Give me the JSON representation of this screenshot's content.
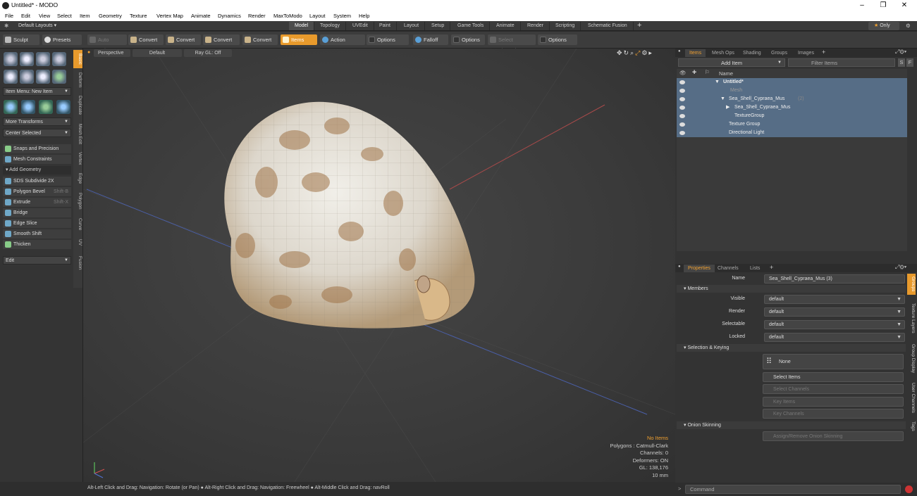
{
  "window": {
    "title": "Untitled* - MODO"
  },
  "menu": [
    "File",
    "Edit",
    "View",
    "Select",
    "Item",
    "Geometry",
    "Texture",
    "Vertex Map",
    "Animate",
    "Dynamics",
    "Render",
    "MaxToModo",
    "Layout",
    "System",
    "Help"
  ],
  "layouts": {
    "label": "Default Layouts ▾"
  },
  "tabs": [
    "Model",
    "Topology",
    "UVEdit",
    "Paint",
    "Layout",
    "Setup",
    "Game Tools",
    "Animate",
    "Render",
    "Scripting",
    "Schematic Fusion"
  ],
  "only_label": "Only",
  "toolbar": {
    "sculpt": "Sculpt",
    "presets": "Presets",
    "presets_key": "F6",
    "auto_select": "Auto Select",
    "convert": "Convert",
    "items": "Items",
    "action_center": "Action Center",
    "options": "Options",
    "falloff": "Falloff",
    "select_through": "Select Through"
  },
  "left": {
    "item_menu": "Item Menu: New Item",
    "more_transforms": "More Transforms",
    "center_selected": "Center Selected",
    "snaps": "Snaps and Precision",
    "mesh_constraints": "Mesh Constraints",
    "add_geometry": "Add Geometry",
    "tools": [
      {
        "label": "SDS Subdivide 2X",
        "key": ""
      },
      {
        "label": "Polygon Bevel",
        "key": "Shift-B"
      },
      {
        "label": "Extrude",
        "key": "Shift-X"
      },
      {
        "label": "Bridge",
        "key": ""
      },
      {
        "label": "Edge Slice",
        "key": ""
      },
      {
        "label": "Smooth Shift",
        "key": ""
      },
      {
        "label": "Thicken",
        "key": ""
      }
    ],
    "edit": "Edit",
    "vtabs": [
      "Basic",
      "Deform",
      "Duplicate",
      "Mesh Edit",
      "Vertex",
      "Edge",
      "Polygon",
      "Curve",
      "UV",
      "Fusion"
    ]
  },
  "viewport": {
    "perspective": "Perspective",
    "default": "Default",
    "raygl": "Ray GL: Off",
    "info": {
      "no_items": "No Items",
      "polygons": "Polygons : Catmull-Clark",
      "channels": "Channels: 0",
      "deformers": "Deformers: ON",
      "gl": "GL: 138,176",
      "scale": "10 mm"
    }
  },
  "status": "Alt-Left Click and Drag: Navigation: Rotate (or Pan) ● Alt-Right Click and Drag: Navigation: Freewheel ● Alt-Middle Click and Drag: navRoll",
  "items_panel": {
    "tabs": [
      "Items",
      "Mesh Ops",
      "Shading",
      "Groups",
      "Images"
    ],
    "add_item": "Add Item",
    "filter": "Filter Items",
    "col_name": "Name",
    "tree": [
      {
        "label": "Untitled*",
        "bold": true
      },
      {
        "label": "Mesh",
        "dim": true
      },
      {
        "label": "Sea_Shell_Cypraea_Mus",
        "suffix": "(2)"
      },
      {
        "label": "Sea_Shell_Cypraea_Mus",
        "suffix": ""
      },
      {
        "label": "TextureGroup",
        "suffix": ""
      },
      {
        "label": "Texture Group",
        "suffix": ""
      },
      {
        "label": "Directional Light",
        "suffix": ""
      }
    ]
  },
  "props_panel": {
    "tabs": [
      "Properties",
      "Channels",
      "Lists"
    ],
    "name_label": "Name",
    "name_value": "Sea_Shell_Cypraea_Mus (3)",
    "members": "Members",
    "fields": [
      {
        "label": "Visible",
        "value": "default"
      },
      {
        "label": "Render",
        "value": "default"
      },
      {
        "label": "Selectable",
        "value": "default"
      },
      {
        "label": "Locked",
        "value": "default"
      }
    ],
    "selection_keying": "Selection & Keying",
    "none": "None",
    "select_items": "Select Items",
    "select_channels": "Select Channels",
    "key_items": "Key Items",
    "key_channels": "Key Channels",
    "onion": "Onion Skinning",
    "assign_onion": "Assign/Remove Onion Skinning",
    "vtabs": [
      "Groups",
      "Texture Layers",
      "Group Display",
      "User Channels",
      "Tags"
    ]
  },
  "command": {
    "placeholder": "Command"
  },
  "colors": {
    "accent": "#e89a2c",
    "selection": "#566d86"
  }
}
